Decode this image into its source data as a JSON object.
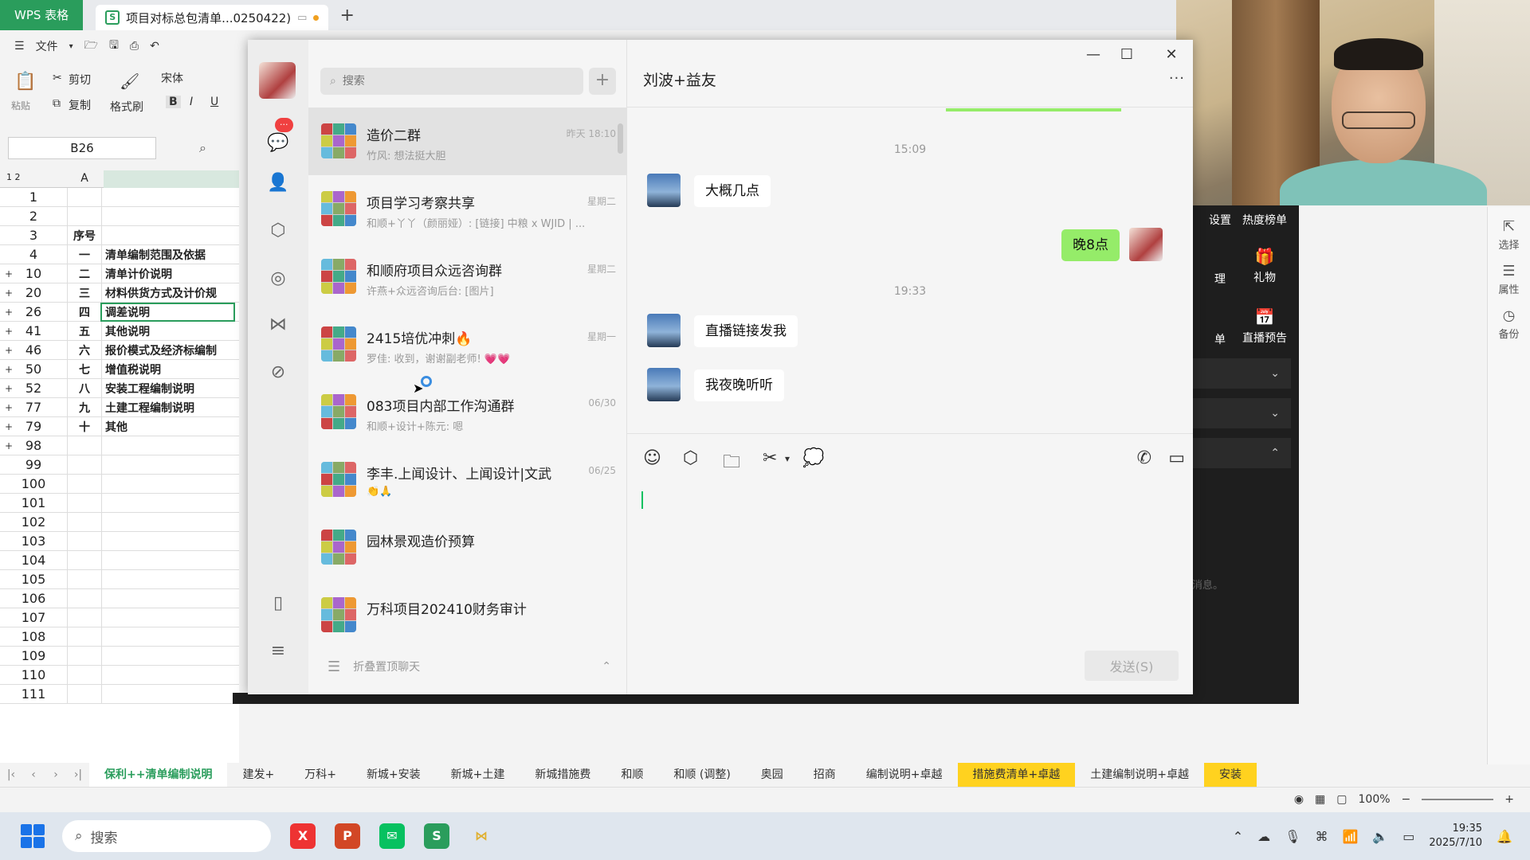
{
  "wps": {
    "brand": "WPS 表格",
    "doc_tab": "项目对标总包清单...0250422)",
    "new_tab": "+",
    "menu": [
      "文件"
    ],
    "ribbon": {
      "cut": "剪切",
      "paste": "粘贴",
      "copy": "复制",
      "format_painter": "格式刷",
      "font": "宋体",
      "bold": "B",
      "italic": "I",
      "underline": "U"
    },
    "name_box": "B26",
    "col_a": "A",
    "rows": [
      {
        "n": "1",
        "a": "",
        "b": "",
        "plus": false
      },
      {
        "n": "2",
        "a": "",
        "b": "",
        "plus": false
      },
      {
        "n": "3",
        "a": "序号",
        "b": "",
        "plus": false
      },
      {
        "n": "4",
        "a": "一",
        "b": "清单编制范围及依据",
        "plus": false
      },
      {
        "n": "10",
        "a": "二",
        "b": "清单计价说明",
        "plus": true
      },
      {
        "n": "20",
        "a": "三",
        "b": "材料供货方式及计价规",
        "plus": true
      },
      {
        "n": "26",
        "a": "四",
        "b": "调差说明",
        "plus": true
      },
      {
        "n": "41",
        "a": "五",
        "b": "其他说明",
        "plus": true
      },
      {
        "n": "46",
        "a": "六",
        "b": "报价模式及经济标编制",
        "plus": true
      },
      {
        "n": "50",
        "a": "七",
        "b": "增值税说明",
        "plus": true
      },
      {
        "n": "52",
        "a": "八",
        "b": "安装工程编制说明",
        "plus": true
      },
      {
        "n": "77",
        "a": "九",
        "b": "土建工程编制说明",
        "plus": true
      },
      {
        "n": "79",
        "a": "十",
        "b": "其他",
        "plus": true
      },
      {
        "n": "98",
        "a": "",
        "b": "",
        "plus": true
      },
      {
        "n": "99",
        "a": "",
        "b": "",
        "plus": false
      },
      {
        "n": "100",
        "a": "",
        "b": "",
        "plus": false
      },
      {
        "n": "101",
        "a": "",
        "b": "",
        "plus": false
      },
      {
        "n": "102",
        "a": "",
        "b": "",
        "plus": false
      },
      {
        "n": "103",
        "a": "",
        "b": "",
        "plus": false
      },
      {
        "n": "104",
        "a": "",
        "b": "",
        "plus": false
      },
      {
        "n": "105",
        "a": "",
        "b": "",
        "plus": false
      },
      {
        "n": "106",
        "a": "",
        "b": "",
        "plus": false
      },
      {
        "n": "107",
        "a": "",
        "b": "",
        "plus": false
      },
      {
        "n": "108",
        "a": "",
        "b": "",
        "plus": false
      },
      {
        "n": "109",
        "a": "",
        "b": "",
        "plus": false
      },
      {
        "n": "110",
        "a": "",
        "b": "",
        "plus": false
      },
      {
        "n": "111",
        "a": "",
        "b": "",
        "plus": false
      }
    ],
    "sheet_tabs": [
      {
        "label": "保利++清单编制说明",
        "state": "active"
      },
      {
        "label": "建发+",
        "state": ""
      },
      {
        "label": "万科+",
        "state": ""
      },
      {
        "label": "新城+安装",
        "state": ""
      },
      {
        "label": "新城+土建",
        "state": ""
      },
      {
        "label": "新城措施费",
        "state": ""
      },
      {
        "label": "和顺",
        "state": ""
      },
      {
        "label": "和顺 (调整)",
        "state": ""
      },
      {
        "label": "奥园",
        "state": ""
      },
      {
        "label": "招商",
        "state": ""
      },
      {
        "label": "编制说明+卓越",
        "state": ""
      },
      {
        "label": "措施费清单+卓越",
        "state": "hl"
      },
      {
        "label": "土建编制说明+卓越",
        "state": ""
      },
      {
        "label": "安装",
        "state": "hl"
      }
    ],
    "zoom": "100%",
    "right_panel": [
      "选择",
      "属性",
      "备份"
    ]
  },
  "live_panel": {
    "items": [
      "设置",
      "热度榜单",
      "理",
      "礼物",
      "单",
      "直播预告"
    ],
    "footer_hint": "消息。"
  },
  "wechat": {
    "search_placeholder": "搜索",
    "add": "+",
    "conversations": [
      {
        "name": "造价二群",
        "time": "昨天 18:10",
        "msg": "竹风: 想法挺大胆",
        "selected": true
      },
      {
        "name": "项目学习考察共享",
        "time": "星期二",
        "msg": "和顺+丫丫（颜丽娅）: [链接] 中粮 x WJID | ...",
        "selected": false
      },
      {
        "name": "和顺府项目众远咨询群",
        "time": "星期二",
        "msg": "许燕+众远咨询后台: [图片]",
        "selected": false
      },
      {
        "name": "2415培优冲刺🔥",
        "time": "星期一",
        "msg": "罗佳: 收到，谢谢副老师! 💗💗",
        "selected": false
      },
      {
        "name": "083项目内部工作沟通群",
        "time": "06/30",
        "msg": "和顺+设计+陈元: 嗯",
        "selected": false
      },
      {
        "name": "李丰.上闻设计、上闻设计|文武",
        "time": "06/25",
        "msg": "👏🙏",
        "selected": false
      },
      {
        "name": "园林景观造价预算",
        "time": "",
        "msg": "",
        "selected": false
      },
      {
        "name": "万科项目202410财务审计",
        "time": "",
        "msg": "",
        "selected": false
      }
    ],
    "fold_label": "折叠置顶聊天",
    "chat_title": "刘波+益友",
    "more": "···",
    "timestamps": [
      "15:09",
      "19:33"
    ],
    "messages": [
      {
        "from": "them",
        "text": "大概几点"
      },
      {
        "from": "me",
        "text": "晚8点"
      },
      {
        "from": "them",
        "text": "直播链接发我"
      },
      {
        "from": "them",
        "text": "我夜晚听听"
      }
    ],
    "send_label": "发送(S)",
    "badge": "···"
  },
  "taskbar": {
    "search_placeholder": "搜索",
    "time": "19:35",
    "date": "2025/7/10"
  },
  "colors": {
    "wechat_green": "#95ec69",
    "wps_green": "#2a9d5c",
    "tab_highlight": "#ffd21f"
  }
}
